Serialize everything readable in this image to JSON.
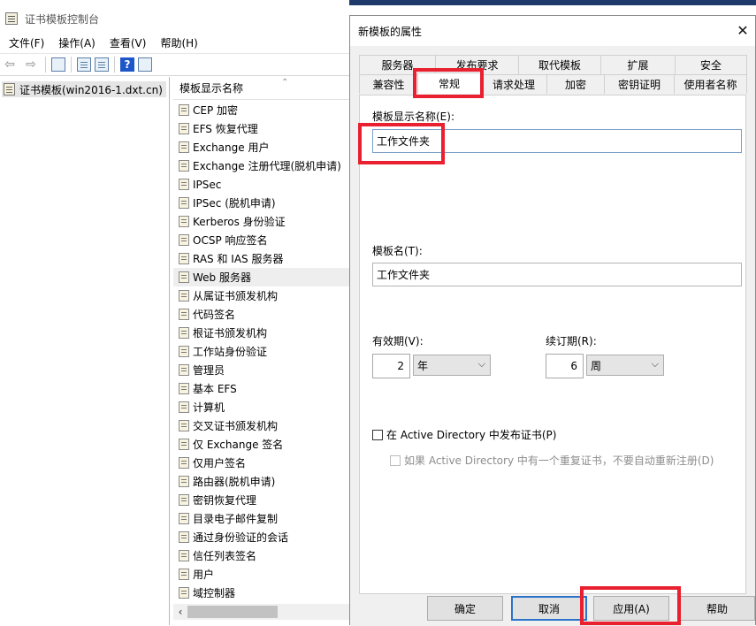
{
  "mmc": {
    "title": "证书模板控制台",
    "menu": [
      "文件(F)",
      "操作(A)",
      "查看(V)",
      "帮助(H)"
    ],
    "tree_item": "证书模板(win2016-1.dxt.cn)",
    "list_header": "模板显示名称",
    "templates": [
      "CEP 加密",
      "EFS 恢复代理",
      "Exchange 用户",
      "Exchange 注册代理(脱机申请)",
      "IPSec",
      "IPSec (脱机申请)",
      "Kerberos 身份验证",
      "OCSP 响应签名",
      "RAS 和 IAS 服务器",
      "Web 服务器",
      "从属证书颁发机构",
      "代码签名",
      "根证书颁发机构",
      "工作站身份验证",
      "管理员",
      "基本 EFS",
      "计算机",
      "交叉证书颁发机构",
      "仅 Exchange 签名",
      "仅用户签名",
      "路由器(脱机申请)",
      "密钥恢复代理",
      "目录电子邮件复制",
      "通过身份验证的会话",
      "信任列表签名",
      "用户",
      "域控制器"
    ],
    "selected_template": "Web 服务器"
  },
  "dialog": {
    "title": "新模板的属性",
    "tabs_back": [
      "服务器",
      "发布要求",
      "取代模板",
      "扩展",
      "安全"
    ],
    "tabs_front": [
      "兼容性",
      "常规",
      "请求处理",
      "加密",
      "密钥证明",
      "使用者名称"
    ],
    "active_tab": "常规",
    "display_name_label": "模板显示名称(E):",
    "display_name_value": "工作文件夹",
    "template_name_label": "模板名(T):",
    "template_name_value": "工作文件夹",
    "validity_label": "有效期(V):",
    "validity_value": "2",
    "validity_unit": "年",
    "renewal_label": "续订期(R):",
    "renewal_value": "6",
    "renewal_unit": "周",
    "publish_ad_label": "在 Active Directory 中发布证书(P)",
    "publish_ad_checked": false,
    "no_auto_reenroll_label": "如果 Active Directory 中有一个重复证书，不要自动重新注册(D)",
    "no_auto_reenroll_checked": false,
    "buttons": {
      "ok": "确定",
      "cancel": "取消",
      "apply": "应用(A)",
      "help": "帮助"
    }
  },
  "colors": {
    "highlight_box": "#e8202f",
    "focus_border": "#2a73c9",
    "dialog_bg": "#f0f0f0"
  }
}
